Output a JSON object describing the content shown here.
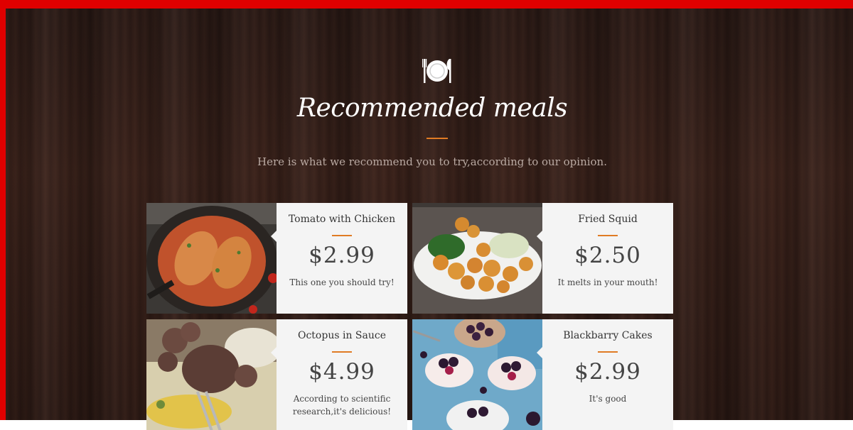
{
  "header": {
    "icon": "plate-cutlery-icon",
    "title": "Recommended meals",
    "subtitle": "Here is what we recommend you to try,according to our opinion."
  },
  "colors": {
    "frame_border": "#e00000",
    "accent": "#e07b24",
    "card_bg": "#f4f4f4"
  },
  "meals": [
    {
      "name": "Tomato with Chicken",
      "price": "$2.99",
      "desc": "This one you should try!",
      "image": "chicken-tomato-skillet-photo"
    },
    {
      "name": "Fried Squid",
      "price": "$2.50",
      "desc": "It melts in your mouth!",
      "image": "fried-squid-plate-photo"
    },
    {
      "name": "Octopus in Sauce",
      "price": "$4.99",
      "desc": "According to scientific research,it's delicious!",
      "image": "octopus-sauce-photo"
    },
    {
      "name": "Blackbarry Cakes",
      "price": "$2.99",
      "desc": "It's good",
      "image": "blackberry-cakes-photo"
    }
  ]
}
